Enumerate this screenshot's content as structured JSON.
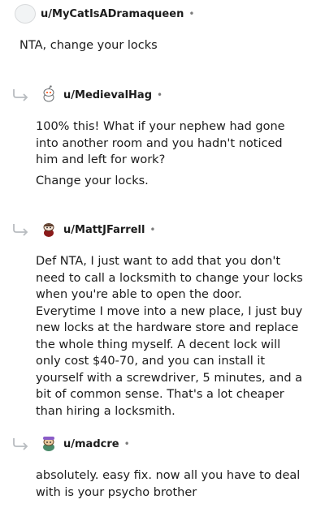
{
  "comments": [
    {
      "username": "u/MyCatIsADramaqueen",
      "separator": "•",
      "avatar_icon": "blank-avatar-icon",
      "paragraphs": [
        "NTA, change your locks"
      ]
    },
    {
      "username": "u/MedievalHag",
      "separator": "•",
      "avatar_icon": "snoo-avatar-icon",
      "reply_icon": "reply-arrow-icon",
      "paragraphs": [
        "100% this! What if your nephew had gone into another room and you hadn't noticed him and left for work?",
        "Change your locks."
      ]
    },
    {
      "username": "u/MattJFarrell",
      "separator": "•",
      "avatar_icon": "snoo-avatar-icon",
      "reply_icon": "reply-arrow-icon",
      "paragraphs": [
        "Def NTA, I just want to add that you don't need to call a locksmith to change your locks when you're able to open the door. Everytime I move into a new place, I just buy new locks at the hardware store and replace the whole thing myself. A decent lock will only cost $40-70, and you can install it yourself with a screwdriver, 5 minutes, and a bit of common sense. That's a lot cheaper than hiring a locksmith."
      ]
    },
    {
      "username": "u/madcre",
      "separator": "•",
      "avatar_icon": "snoo-avatar-icon",
      "reply_icon": "reply-arrow-icon",
      "paragraphs": [
        "absolutely. easy fix. now all you have to deal with is your psycho brother"
      ]
    }
  ]
}
